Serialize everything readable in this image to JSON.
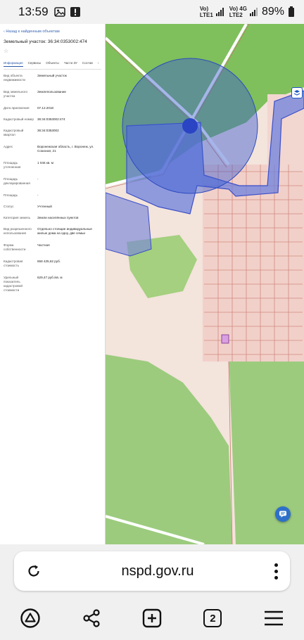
{
  "status_bar": {
    "time": "13:59",
    "sim1_top": "Vo)",
    "sim1_bottom": "LTE1",
    "sim2_top": "Vo) 4G",
    "sim2_bottom": "LTE2",
    "battery": "89%"
  },
  "panel": {
    "back_link": "‹ Назад к найденным объектам",
    "title": "Земельный участок: 36:34:0353002:474",
    "star": "☆",
    "tabs": [
      "Информация",
      "Сервисы",
      "Объекты",
      "Части ЗУ",
      "Состав"
    ],
    "tabs_more": "›",
    "properties": [
      {
        "label": "Вид объекта недвижимости",
        "value": "Земельный участок"
      },
      {
        "label": "Вид земельного участка",
        "value": "Землепользование"
      },
      {
        "label": "Дата присвоения",
        "value": "07.12.2018"
      },
      {
        "label": "Кадастровый номер",
        "value": "36:34:0353002:474"
      },
      {
        "label": "Кадастровый квартал",
        "value": "36:34:0353002"
      },
      {
        "label": "Адрес",
        "value": "Воронежская область, г. Воронеж, ул. Союзная, 21"
      },
      {
        "label": "Площадь уточненная",
        "value": "1 046 кв. м"
      },
      {
        "label": "Площадь декларированная",
        "value": "-"
      },
      {
        "label": "Площадь",
        "value": "-"
      },
      {
        "label": "Статус",
        "value": "Учтенный"
      },
      {
        "label": "Категория земель",
        "value": "Земли населённых пунктов"
      },
      {
        "label": "Вид разрешенного использования",
        "value": "Отдельно стоящие индивидуальные жилые дома на одну, две семьи"
      },
      {
        "label": "Форма собственности",
        "value": "Частная"
      },
      {
        "label": "Кадастровая стоимость",
        "value": "658 425,62 руб."
      },
      {
        "label": "Удельный показатель кадастровой стоимости",
        "value": "629,47 руб./кв. м"
      }
    ]
  },
  "browser": {
    "url": "nspd.gov.ru",
    "tabs_count": "2"
  },
  "colors": {
    "accent": "#2b57a7",
    "green_field": "#8fc46e",
    "pale_zone": "#f5e6df",
    "parcel_blue": "#5b6fd6",
    "residential_pink": "#f2c9c3"
  },
  "icons": {
    "notification_1": "photo-icon",
    "notification_2": "alert-icon",
    "reload": "reload-icon",
    "menu": "more-vertical-icon",
    "home": "browser-logo-icon",
    "share": "share-icon",
    "new_tab": "add-tab-icon",
    "tabs": "tabs-icon",
    "main_menu": "hamburger-icon",
    "chat": "chat-icon",
    "map_tool": "map-layers-icon"
  }
}
